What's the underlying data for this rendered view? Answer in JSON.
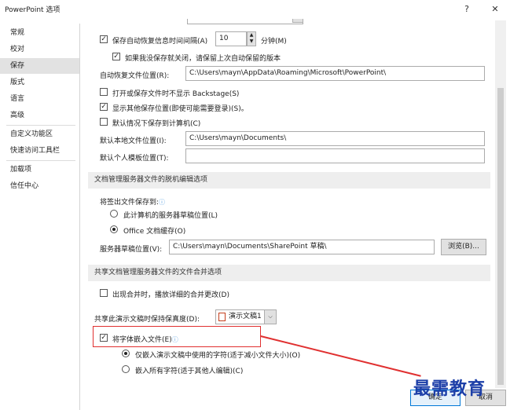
{
  "window": {
    "title": "PowerPoint 选项",
    "help": "?",
    "close": "✕"
  },
  "sidebar": {
    "items": [
      "常规",
      "校对",
      "保存",
      "版式",
      "语言",
      "高级",
      "自定义功能区",
      "快速访问工具栏",
      "加载项",
      "信任中心"
    ],
    "active_index": 2
  },
  "save": {
    "autorecover_label": "保存自动恢复信息时间间隔(A)",
    "autorecover_value": "10",
    "minutes_label": "分钟(M)",
    "keep_last_label": "如果我没保存就关闭，请保留上次自动保留的版本",
    "autorecover_loc_label": "自动恢复文件位置(R):",
    "autorecover_loc_value": "C:\\Users\\mayn\\AppData\\Roaming\\Microsoft\\PowerPoint\\",
    "no_backstage_label": "打开或保存文件时不显示 Backstage(S)",
    "show_other_label": "显示其他保存位置(即使可能需要登录)(S)。",
    "default_computer_label": "默认情况下保存到计算机(C)",
    "local_loc_label": "默认本地文件位置(I):",
    "local_loc_value": "C:\\Users\\mayn\\Documents\\",
    "template_loc_label": "默认个人模板位置(T):",
    "template_loc_value": ""
  },
  "offline": {
    "header": "文档管理服务器文件的脱机编辑选项",
    "checkout_label": "将签出文件保存到:",
    "option_server": "此计算机的服务器草稿位置(L)",
    "option_office": "Office 文档缓存(O)",
    "drafts_label": "服务器草稿位置(V):",
    "drafts_value": "C:\\Users\\mayn\\Documents\\SharePoint 草稿\\",
    "browse": "浏览(B)..."
  },
  "merge": {
    "header": "共享文档管理服务器文件的文件合并选项",
    "show_detail_label": "出现合并时，播放详细的合并更改(D)"
  },
  "fidelity": {
    "label": "共享此演示文稿时保持保真度(D):",
    "doc_value": "演示文稿1",
    "embed_label": "将字体嵌入文件(E)",
    "embed_used_label": "仅嵌入演示文稿中使用的字符(适于减小文件大小)(O)",
    "embed_all_label": "嵌入所有字符(适于其他人编辑)(C)"
  },
  "footer": {
    "ok": "确定",
    "cancel": "取消"
  },
  "watermark": "最需教育",
  "colors": {
    "accent": "#0078d7",
    "highlight": "#e03030",
    "watermark": "#1d3fa8"
  }
}
